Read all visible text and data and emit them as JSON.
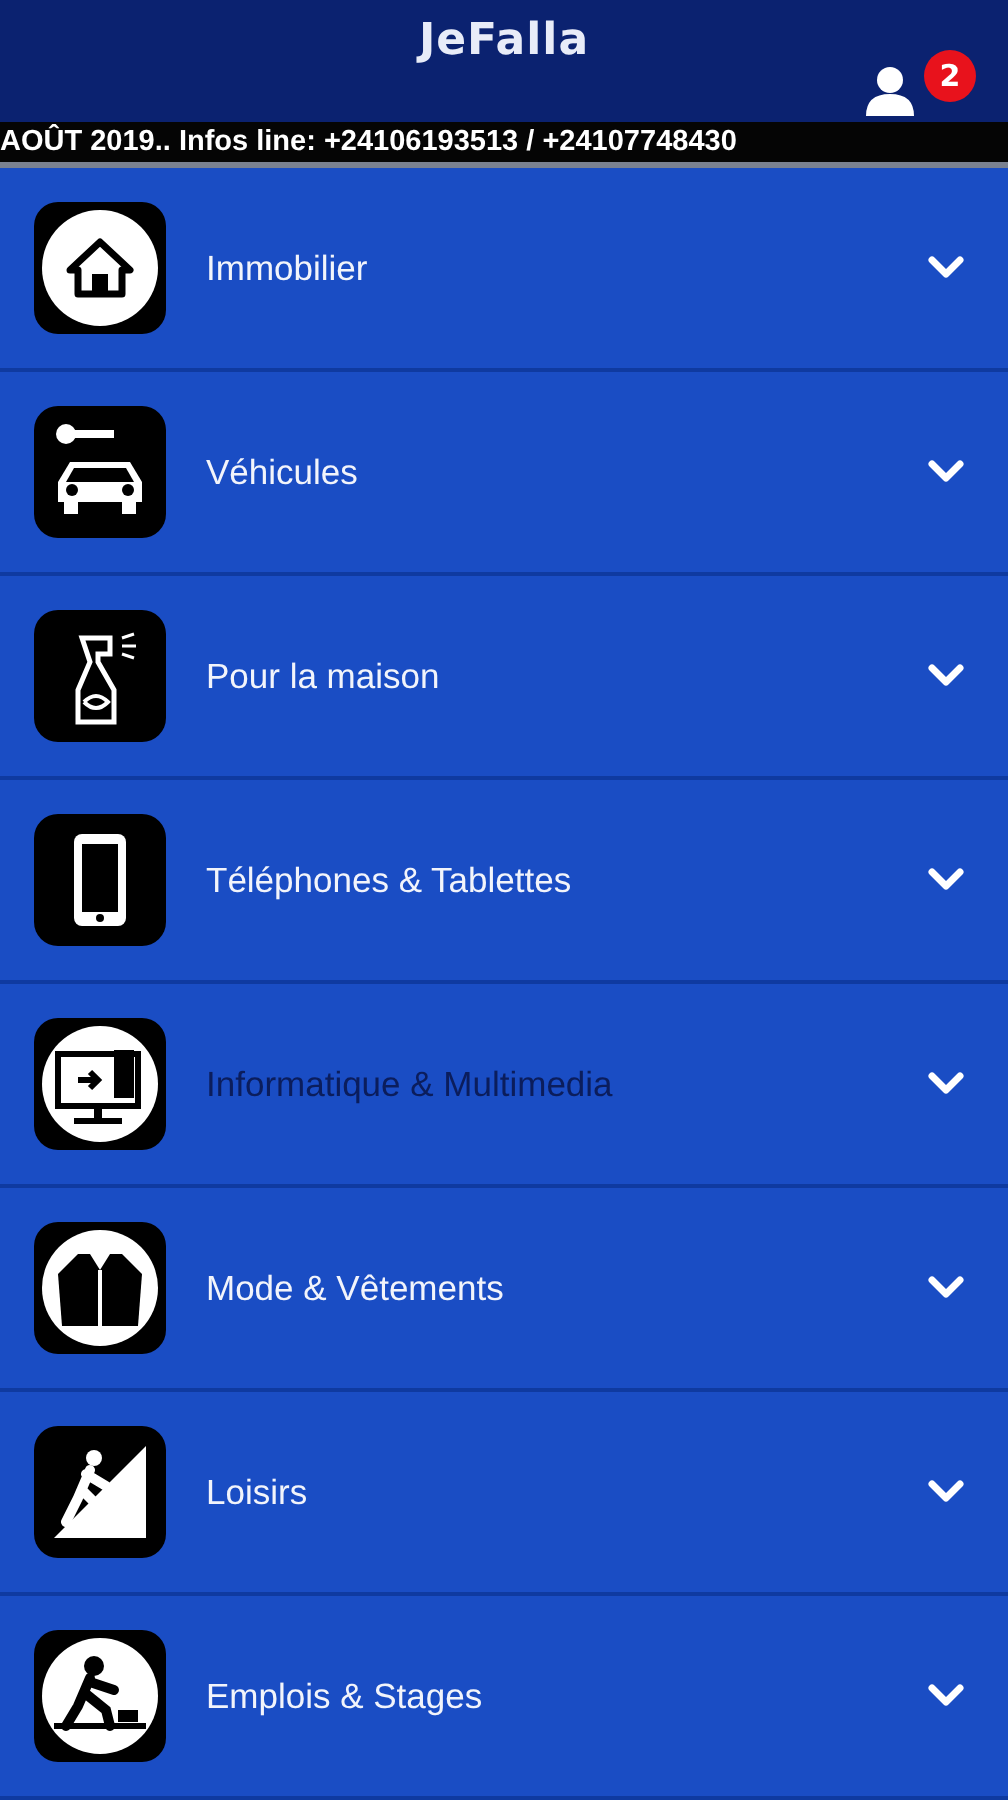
{
  "app_bar": {
    "title": "JeFalla",
    "notification_count": "2"
  },
  "ticker": "AOÛT 2019.. Infos line: +24106193513 / +24107748430",
  "categories": [
    {
      "label": "Immobilier",
      "selected": false
    },
    {
      "label": "Véhicules",
      "selected": false
    },
    {
      "label": "Pour la maison",
      "selected": false
    },
    {
      "label": "Téléphones & Tablettes",
      "selected": false
    },
    {
      "label": "Informatique & Multimedia",
      "selected": true
    },
    {
      "label": "Mode & Vêtements",
      "selected": false
    },
    {
      "label": "Loisirs",
      "selected": false
    },
    {
      "label": "Emplois & Stages",
      "selected": false
    }
  ]
}
